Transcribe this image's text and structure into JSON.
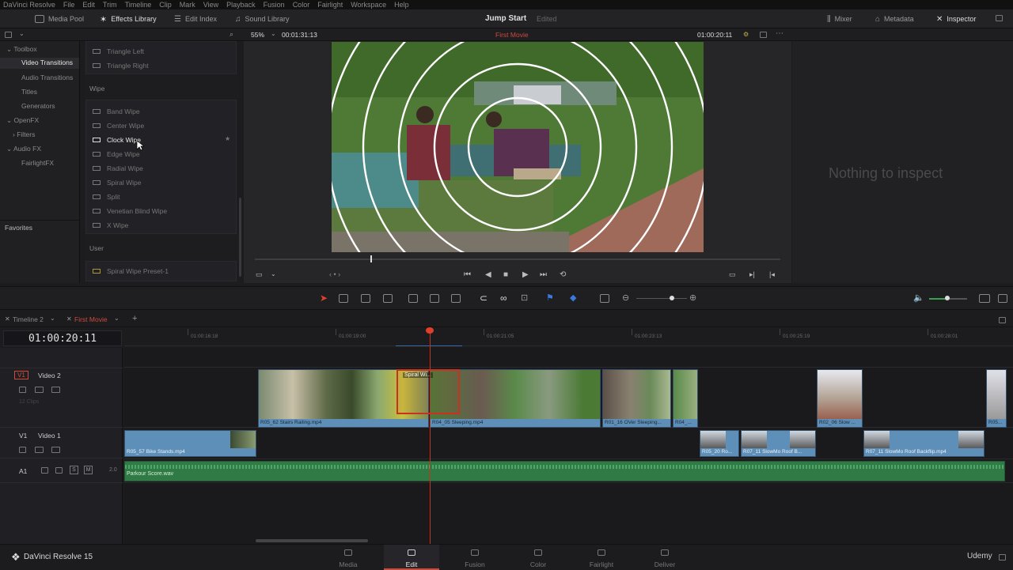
{
  "menu": [
    "DaVinci Resolve",
    "File",
    "Edit",
    "Trim",
    "Timeline",
    "Clip",
    "Mark",
    "View",
    "Playback",
    "Fusion",
    "Color",
    "Fairlight",
    "Workspace",
    "Help"
  ],
  "toolbar": {
    "media_pool": "Media Pool",
    "effects_library": "Effects Library",
    "edit_index": "Edit Index",
    "sound_library": "Sound Library",
    "project_title": "Jump Start",
    "project_status": "Edited",
    "mixer": "Mixer",
    "metadata": "Metadata",
    "inspector": "Inspector"
  },
  "viewer_bar": {
    "zoom": "55%",
    "source_tc": "00:01:31:13",
    "timeline_name": "First Movie",
    "record_tc": "01:00:20:11"
  },
  "toolbox": {
    "items": [
      "Toolbox",
      "Video Transitions",
      "Audio Transitions",
      "Titles",
      "Generators",
      "OpenFX",
      "Filters",
      "Audio FX",
      "FairlightFX"
    ],
    "selected": "Video Transitions",
    "favorites": "Favorites"
  },
  "fx": {
    "top_items": [
      "Triangle Left",
      "Triangle Right"
    ],
    "wipe_header": "Wipe",
    "wipe_items": [
      "Band Wipe",
      "Center Wipe",
      "Clock Wipe",
      "Edge Wipe",
      "Radial Wipe",
      "Spiral Wipe",
      "Split",
      "Venetian Blind Wipe",
      "X Wipe"
    ],
    "highlighted": "Clock Wipe",
    "user_header": "User",
    "user_items": [
      "Spiral Wipe Preset-1"
    ]
  },
  "inspector": {
    "empty_text": "Nothing to inspect"
  },
  "timeline": {
    "tabs": [
      "Timeline 2",
      "First Movie"
    ],
    "active_tab": "First Movie",
    "timecode": "01:00:20:11",
    "ruler": [
      "01:00:16:18",
      "01:00:19:00",
      "01:00:21:05",
      "01:00:23:13",
      "01:00:25:19",
      "01:00:28:01"
    ],
    "tracks": {
      "v2": {
        "id": "V1",
        "name": "Video 2",
        "clips_note": "12 Clips"
      },
      "v1": {
        "id": "V1",
        "name": "Video 1"
      },
      "a1": {
        "id": "A1",
        "level": "2.0",
        "s": "S",
        "m": "M"
      }
    },
    "v2_clips": [
      "R05_62 Stairs Railing.mp4",
      "R04_05 Sleeping.mp4",
      "R01_16 OVer Sleeping...",
      "R04_...",
      "R02_06 Slow ...",
      "R05..."
    ],
    "transition_label": "Spiral Wi...",
    "v1_clips": [
      "R05_57 Bike Stands.mp4",
      "R05_20 Ro...",
      "R07_11 SlowMo Roof B...",
      "R07_11 SlowMo Roof Backflip.mp4"
    ],
    "audio_clip": "Parkour Score.wav"
  },
  "bottom": {
    "brand": "DaVinci Resolve 15",
    "pages": [
      "Media",
      "Edit",
      "Fusion",
      "Color",
      "Fairlight",
      "Deliver"
    ],
    "active_page": "Edit",
    "watermark": "Udemy"
  },
  "colors": {
    "accent_red": "#d04a3a",
    "video_clip": "#5e8fb8",
    "audio_clip": "#2f7a45"
  }
}
